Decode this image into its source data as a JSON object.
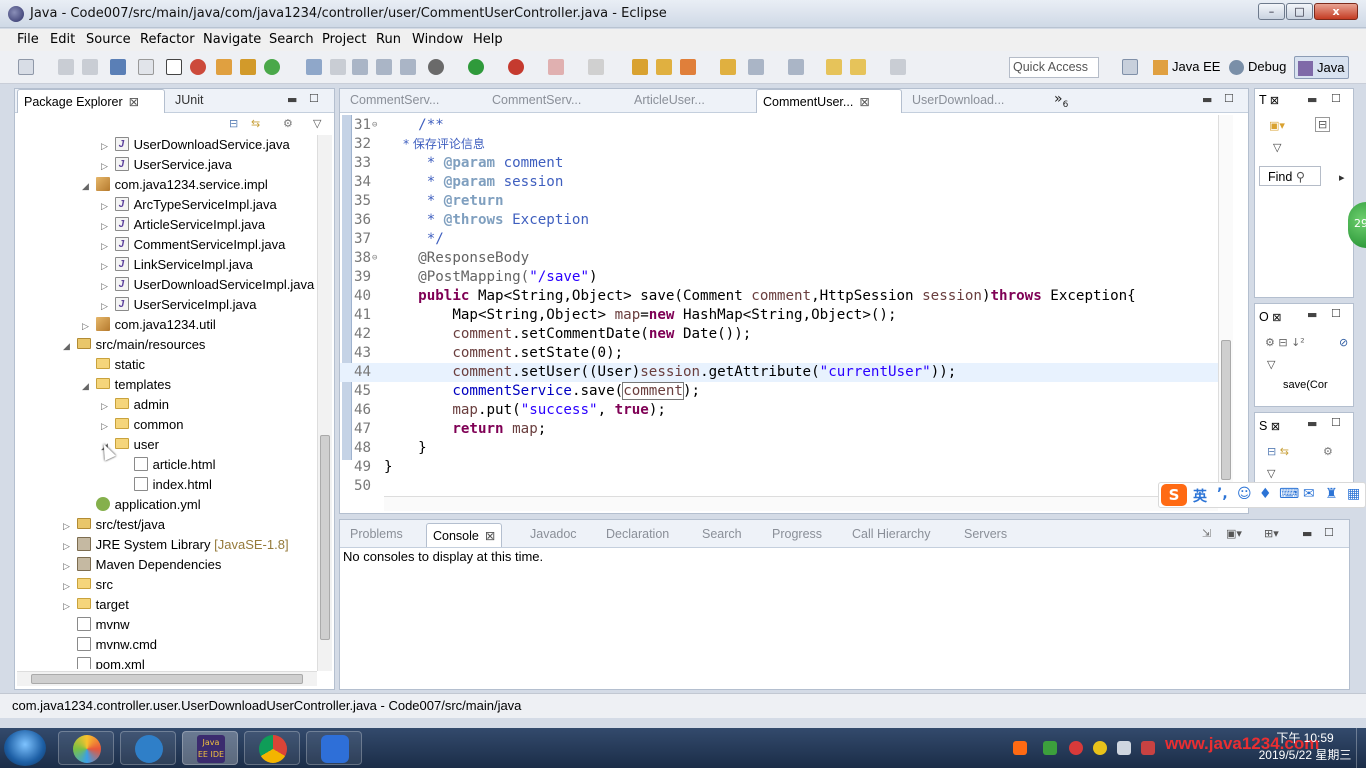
{
  "window": {
    "title": "Java - Code007/src/main/java/com/java1234/controller/user/CommentUserController.java - Eclipse",
    "min": "–",
    "max": "□",
    "close": "x"
  },
  "menu": [
    "File",
    "Edit",
    "Source",
    "Refactor",
    "Navigate",
    "Search",
    "Project",
    "Run",
    "Window",
    "Help"
  ],
  "toolbar": {
    "quick_access": "Quick Access",
    "perspectives": [
      "Java EE",
      "Debug",
      "Java"
    ]
  },
  "explorer": {
    "tabs": [
      {
        "label": "Package Explorer",
        "close": "⊠"
      },
      {
        "label": "JUnit"
      }
    ],
    "tree": [
      {
        "text": "UserDownloadService.java",
        "icon": "java",
        "twisty": "▷"
      },
      {
        "text": "UserService.java",
        "icon": "java",
        "twisty": "▷"
      },
      {
        "text": "com.java1234.service.impl",
        "icon": "package",
        "twisty": "◢"
      },
      {
        "text": "ArcTypeServiceImpl.java",
        "icon": "java",
        "twisty": "▷"
      },
      {
        "text": "ArticleServiceImpl.java",
        "icon": "java",
        "twisty": "▷"
      },
      {
        "text": "CommentServiceImpl.java",
        "icon": "java",
        "twisty": "▷"
      },
      {
        "text": "LinkServiceImpl.java",
        "icon": "java",
        "twisty": "▷"
      },
      {
        "text": "UserDownloadServiceImpl.java",
        "icon": "java",
        "twisty": "▷"
      },
      {
        "text": "UserServiceImpl.java",
        "icon": "java",
        "twisty": "▷"
      },
      {
        "text": "com.java1234.util",
        "icon": "package",
        "twisty": "▷"
      },
      {
        "text": "src/main/resources",
        "icon": "source-folder",
        "twisty": "◢"
      },
      {
        "text": "static",
        "icon": "folder",
        "twisty": ""
      },
      {
        "text": "templates",
        "icon": "folder",
        "twisty": "◢"
      },
      {
        "text": "admin",
        "icon": "folder",
        "twisty": "▷"
      },
      {
        "text": "common",
        "icon": "folder",
        "twisty": "▷"
      },
      {
        "text": "user",
        "icon": "folder",
        "twisty": "◢"
      },
      {
        "text": "article.html",
        "icon": "html",
        "twisty": ""
      },
      {
        "text": "index.html",
        "icon": "html",
        "twisty": ""
      },
      {
        "text": "application.yml",
        "icon": "yml",
        "twisty": ""
      },
      {
        "text": "src/test/java",
        "icon": "source-folder",
        "twisty": "▷"
      },
      {
        "text": "JRE System Library",
        "suffix": "[JavaSE-1.8]",
        "icon": "library",
        "twisty": "▷"
      },
      {
        "text": "Maven Dependencies",
        "icon": "library",
        "twisty": "▷"
      },
      {
        "text": "src",
        "icon": "folder",
        "twisty": "▷"
      },
      {
        "text": "target",
        "icon": "folder",
        "twisty": "▷"
      },
      {
        "text": "mvnw",
        "icon": "file",
        "twisty": ""
      },
      {
        "text": "mvnw.cmd",
        "icon": "file",
        "twisty": ""
      },
      {
        "text": "pom.xml",
        "icon": "file",
        "twisty": ""
      }
    ]
  },
  "editor": {
    "tabs": [
      "CommentServ...",
      "CommentServ...",
      "ArticleUser...",
      "CommentUser...",
      "UserDownload..."
    ],
    "tab_close": "⊠",
    "overflow": "»",
    "overflow_count": "6",
    "lines": [
      {
        "n": "31",
        "fold": "⊖"
      },
      {
        "n": "32"
      },
      {
        "n": "33"
      },
      {
        "n": "34"
      },
      {
        "n": "35"
      },
      {
        "n": "36"
      },
      {
        "n": "37"
      },
      {
        "n": "38",
        "fold": "⊖"
      },
      {
        "n": "39"
      },
      {
        "n": "40"
      },
      {
        "n": "41"
      },
      {
        "n": "42"
      },
      {
        "n": "43"
      },
      {
        "n": "44"
      },
      {
        "n": "45"
      },
      {
        "n": "46"
      },
      {
        "n": "47"
      },
      {
        "n": "48"
      },
      {
        "n": "49"
      },
      {
        "n": "50"
      }
    ],
    "code": {
      "l31": "    /**",
      "l32": "     * 保存评论信息",
      "l33_tag": "@param",
      "l33_rest": " comment",
      "l34_tag": "@param",
      "l34_rest": " session",
      "l35_tag": "@return",
      "l36_tag": "@throws",
      "l36_rest": " Exception",
      "l37": "     */",
      "l38": "    @ResponseBody",
      "l39_a": "    @PostMapping(",
      "l39_s": "\"/save\"",
      "l39_b": ")",
      "l40_kw": "public",
      "l40_a": " Map<String,Object> save(Comment ",
      "l40_p1": "comment",
      "l40_b": ",HttpSession ",
      "l40_p2": "session",
      "l40_c": ")",
      "l40_kw2": "throws",
      "l40_d": " Exception{",
      "l41_a": "        Map<String,Object> ",
      "l41_v": "map",
      "l41_b": "=",
      "l41_kw": "new",
      "l41_c": " HashMap<String,Object>();",
      "l42_p": "comment",
      "l42_a": ".setCommentDate(",
      "l42_kw": "new",
      "l42_b": " Date());",
      "l43_p": "comment",
      "l43_a": ".setState(0);",
      "l44_p": "comment",
      "l44_a": ".setUser((User)",
      "l44_p2": "session",
      "l44_b": ".getAttribute(",
      "l44_s": "\"currentUser\"",
      "l44_c": "));",
      "l45_f": "commentService",
      "l45_a": ".save(",
      "l45_p": "comment",
      "l45_b": ");",
      "l46_v": "map",
      "l46_a": ".put(",
      "l46_s": "\"success\"",
      "l46_b": ", ",
      "l46_kw": "true",
      "l46_c": ");",
      "l47_kw": "return",
      "l47_v": " map",
      "l47_a": ";",
      "l48": "    }",
      "l49": "}"
    }
  },
  "bottom": {
    "tabs": [
      "Problems",
      "Console",
      "Javadoc",
      "Declaration",
      "Search",
      "Progress",
      "Call Hierarchy",
      "Servers"
    ],
    "console_close": "⊠",
    "message": "No consoles to display at this time."
  },
  "right": {
    "tab_t": "T",
    "tab_o": "O",
    "tab_s": "S",
    "find": "Find",
    "outline_item": "save(Cor",
    "badge": "29"
  },
  "ime": {
    "logo": "S",
    "lang": "英",
    "punct": "’,"
  },
  "statusbar": {
    "text": "com.java1234.controller.user.UserDownloadUserController.java - Code007/src/main/java"
  },
  "taskbar": {
    "time": "下午 10:59",
    "date": "2019/5/22 星期三",
    "watermark": "www.java1234.com",
    "eclipse_label": "Java EE IDE"
  },
  "colors": {
    "keyword": "#7f0055",
    "comment": "#3f5fbf",
    "string": "#2a00ff",
    "field": "#0000c0",
    "param": "#6a3e3e",
    "annotation": "#646464",
    "current_line": "#e8f2fe"
  }
}
